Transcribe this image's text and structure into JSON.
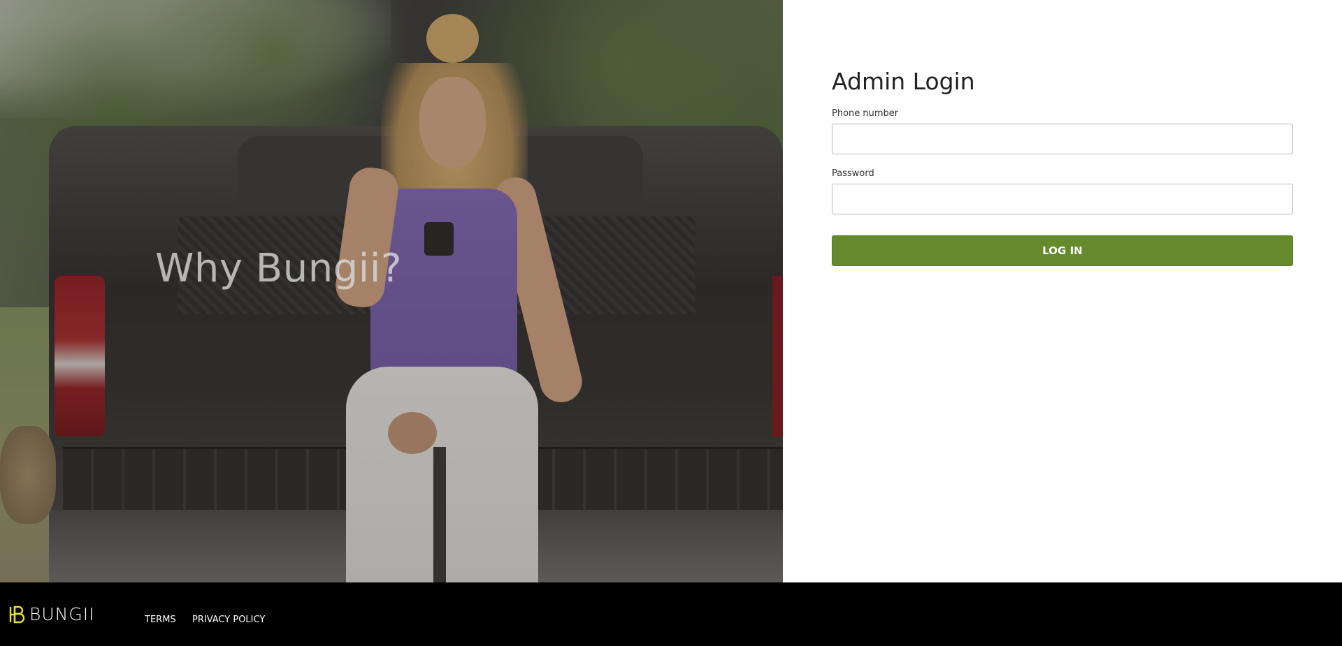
{
  "hero": {
    "title": "Why Bungii?"
  },
  "login": {
    "title": "Admin Login",
    "phone_label": "Phone number",
    "phone_value": "",
    "phone_placeholder": "",
    "password_label": "Password",
    "password_value": "",
    "password_placeholder": "",
    "submit_label": "LOG IN"
  },
  "footer": {
    "brand_name": "BUNGII",
    "brand_icon": "bungii-logo-icon",
    "links": [
      {
        "label": "TERMS"
      },
      {
        "label": "PRIVACY POLICY"
      }
    ]
  },
  "colors": {
    "accent": "#648a2c",
    "footer_bg": "#000000",
    "logo": "#e8e02a"
  }
}
